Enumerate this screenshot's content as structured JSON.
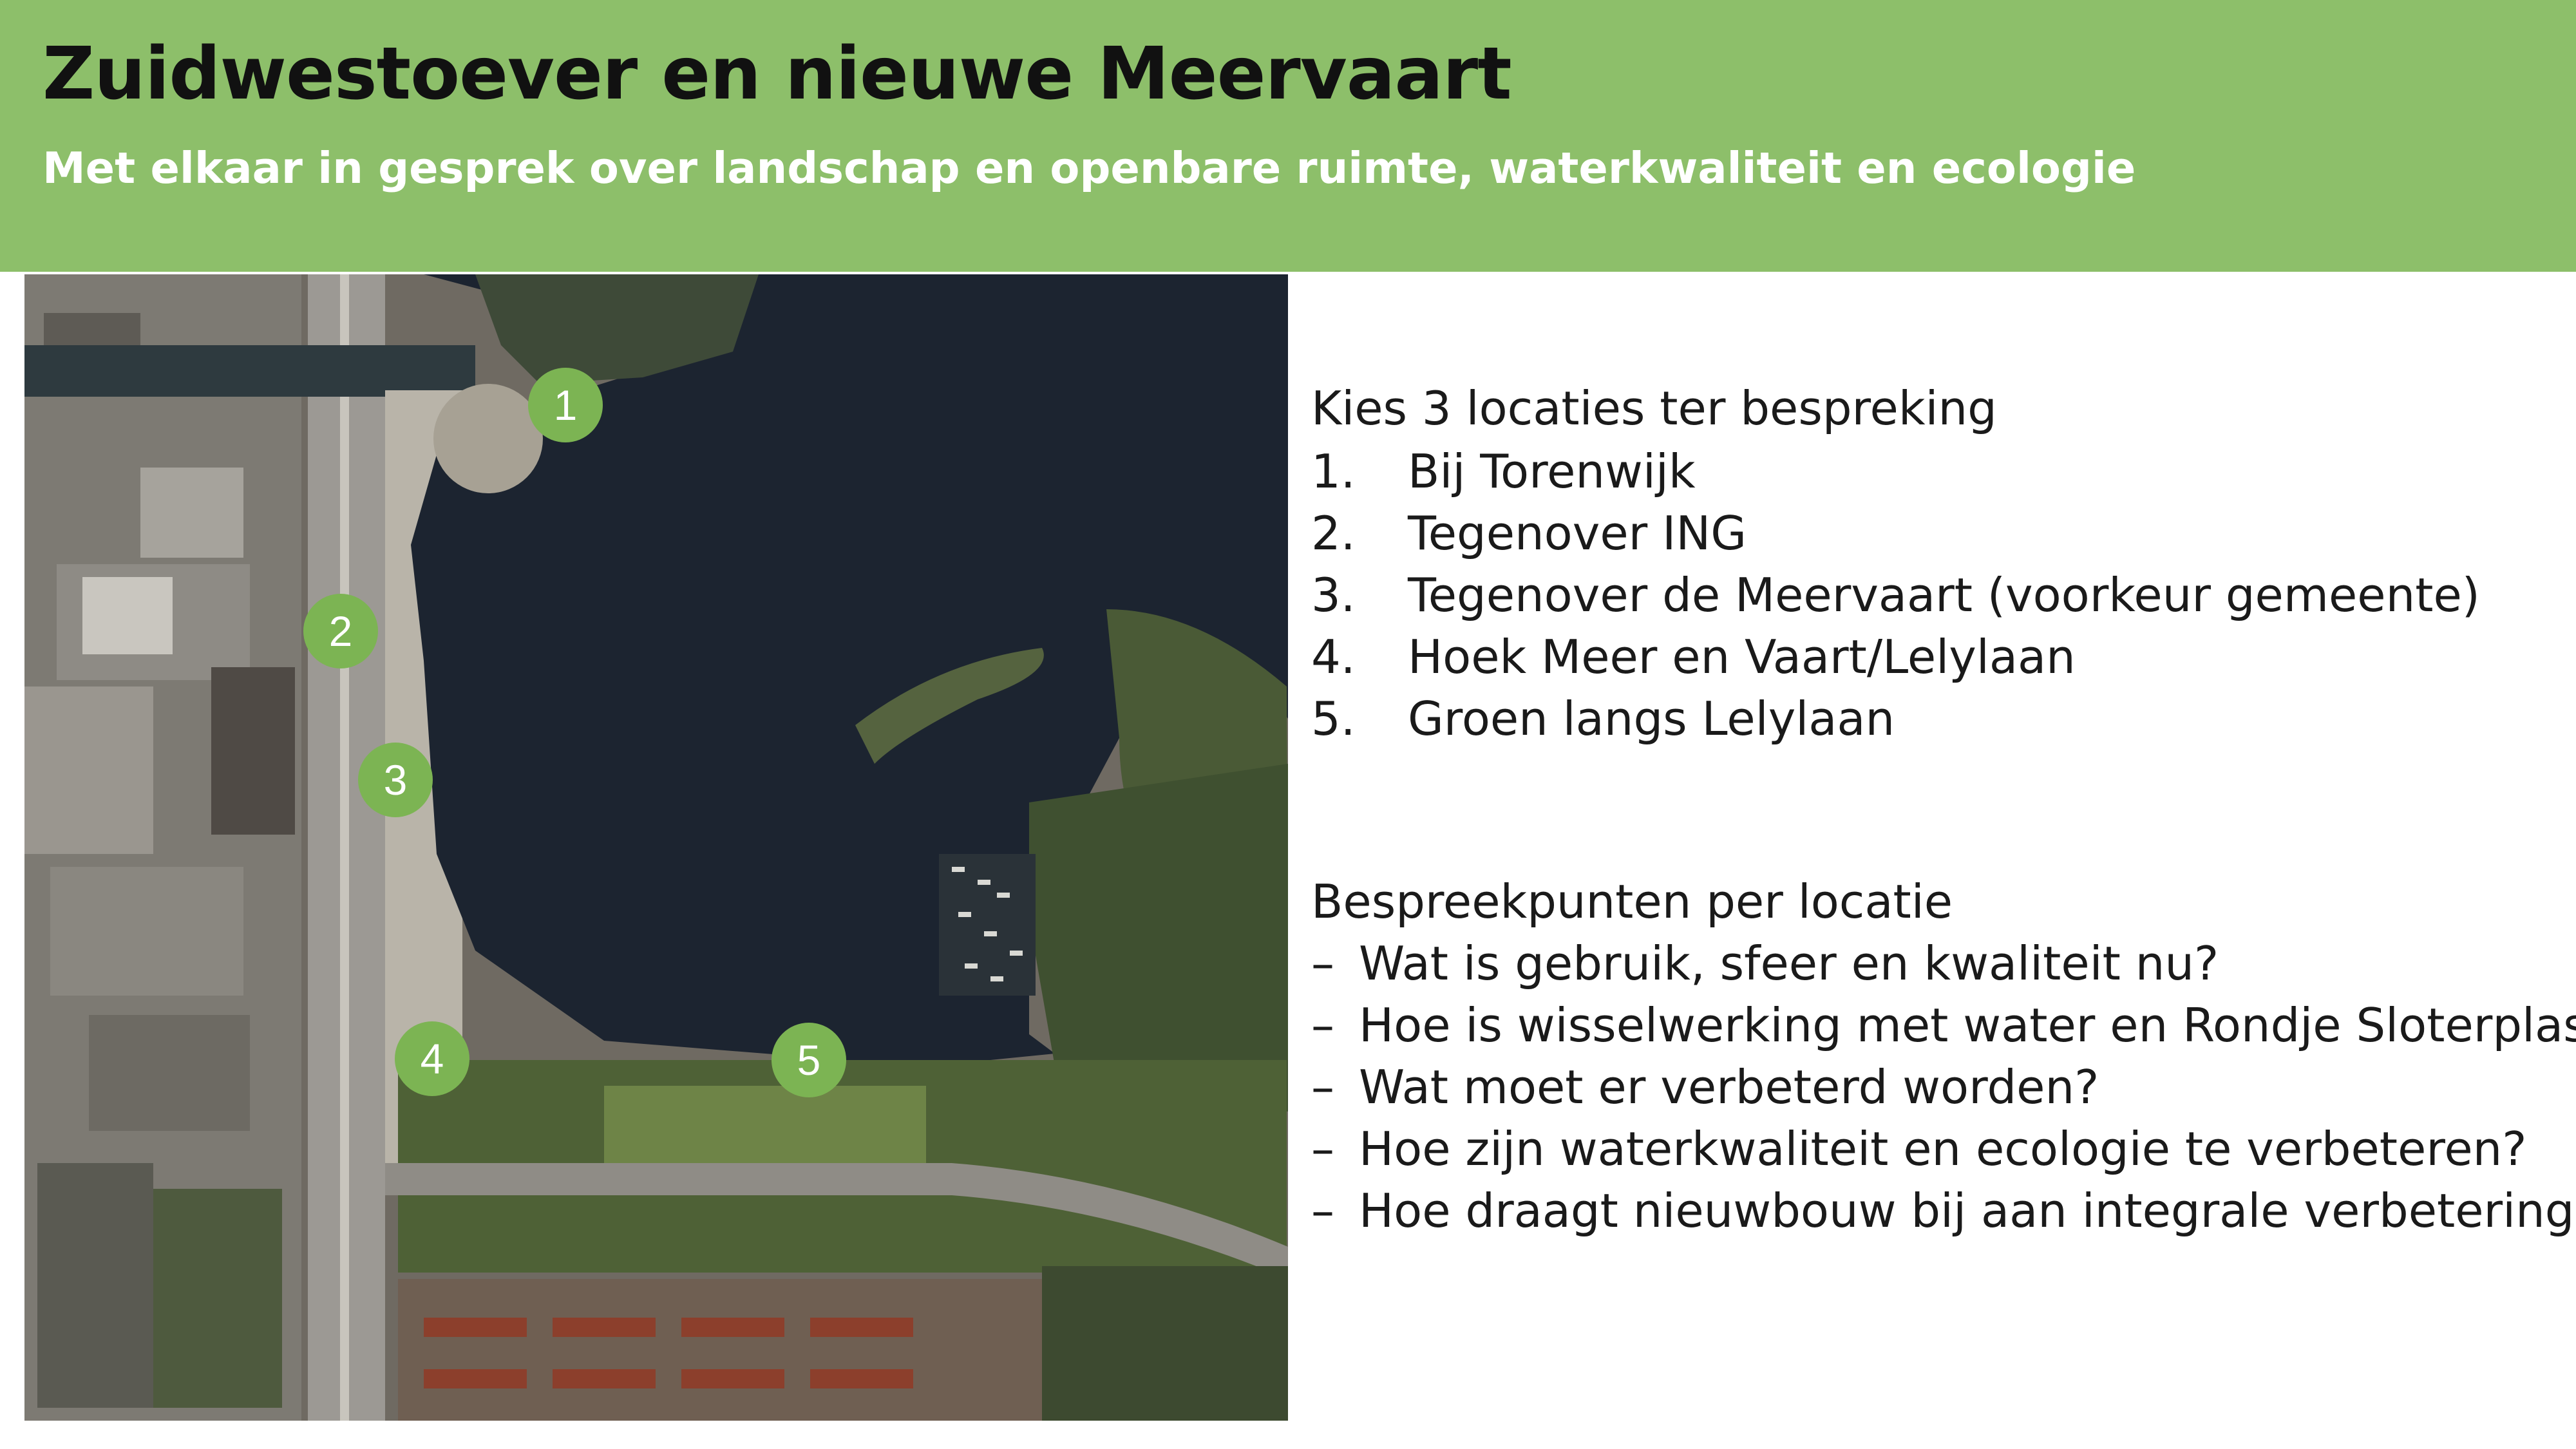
{
  "header": {
    "title": "Zuidwestoever en nieuwe Meervaart",
    "subtitle": "Met elkaar in gesprek over landschap en openbare ruimte, waterkwaliteit en ecologie"
  },
  "map": {
    "markers": [
      "1",
      "2",
      "3",
      "4",
      "5"
    ]
  },
  "locations": {
    "heading": "Kies 3 locaties ter bespreking",
    "items": [
      {
        "num": "1.",
        "label": "Bij Torenwijk"
      },
      {
        "num": "2.",
        "label": "Tegenover ING"
      },
      {
        "num": "3.",
        "label": "Tegenover de Meervaart (voorkeur gemeente)"
      },
      {
        "num": "4.",
        "label": "Hoek Meer en Vaart/Lelylaan"
      },
      {
        "num": "5.",
        "label": "Groen langs Lelylaan"
      }
    ]
  },
  "discussion": {
    "heading": "Bespreekpunten per locatie",
    "bullet": "–",
    "points": [
      "Wat is gebruik, sfeer en kwaliteit nu?",
      "Hoe is wisselwerking met water en Rondje Sloterplas?",
      "Wat moet er verbeterd worden?",
      "Hoe zijn waterkwaliteit en ecologie te verbeteren?",
      "Hoe draagt nieuwbouw bij aan integrale verbetering?"
    ]
  },
  "colors": {
    "banner": "#8dbf6a",
    "marker": "#7cb453",
    "water": "#1c2430"
  }
}
